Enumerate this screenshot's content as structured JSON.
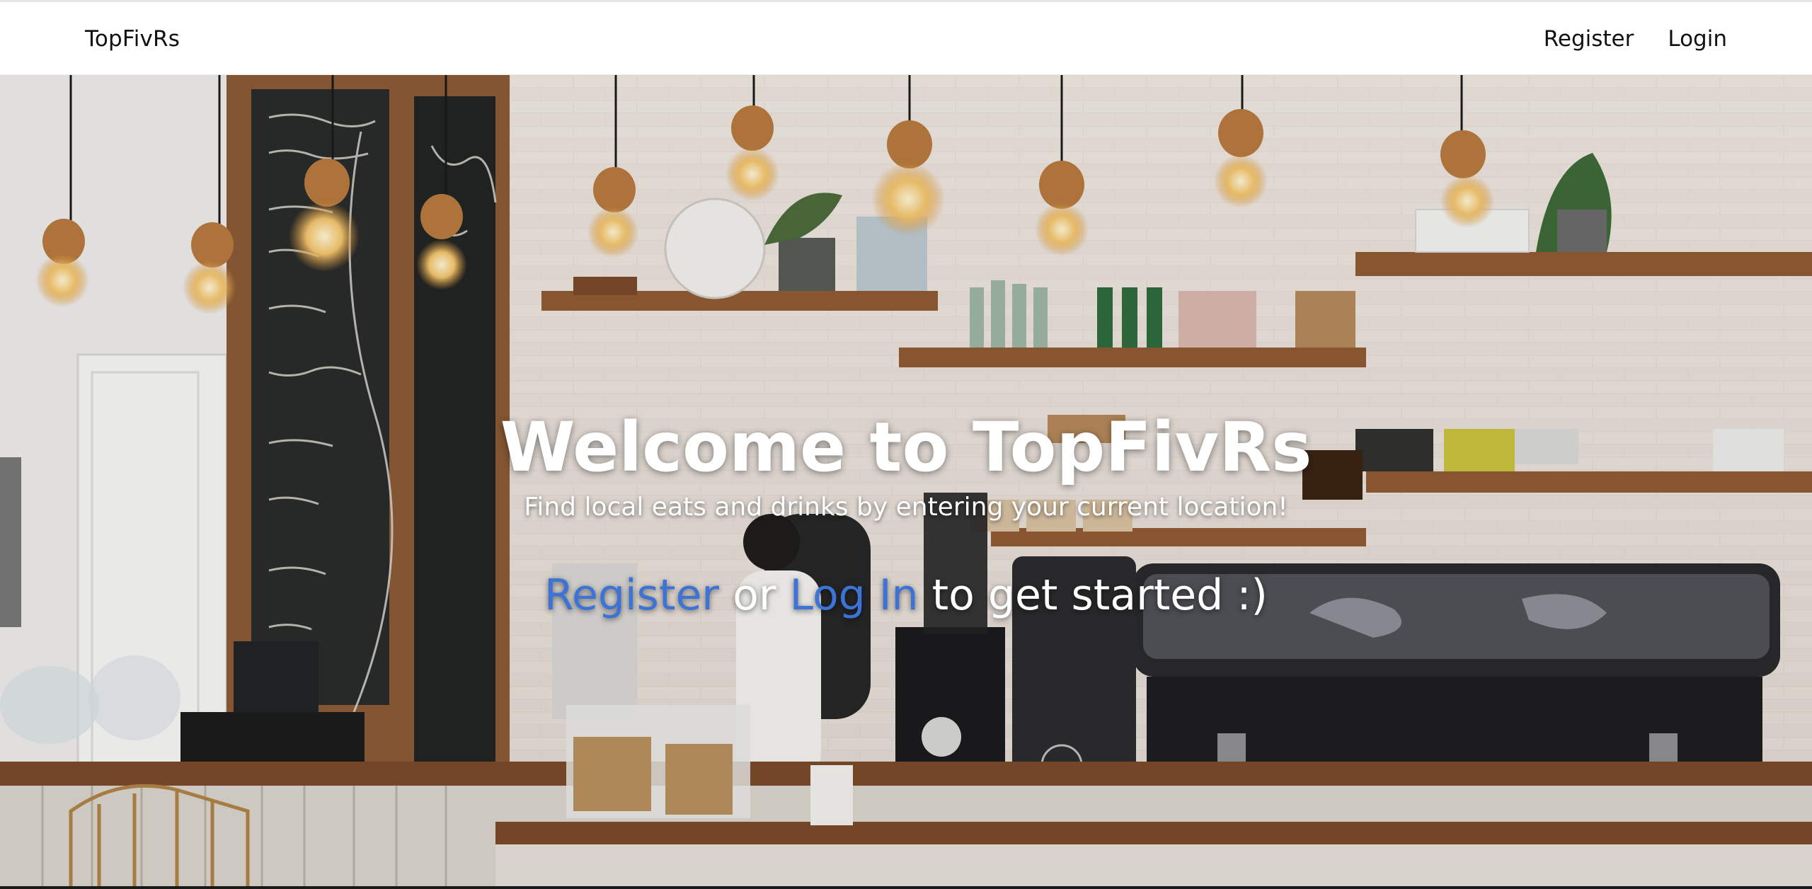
{
  "navbar": {
    "brand": "TopFivRs",
    "register_label": "Register",
    "login_label": "Login"
  },
  "hero": {
    "title": "Welcome to TopFivRs",
    "subtitle": "Find local eats and drinks by entering your current location!",
    "cta_register": "Register",
    "cta_or": " or ",
    "cta_login": "Log In",
    "cta_suffix": " to get started :)"
  },
  "colors": {
    "link_blue": "#3d73d6",
    "text_white": "#ffffff",
    "nav_text": "#111111"
  }
}
